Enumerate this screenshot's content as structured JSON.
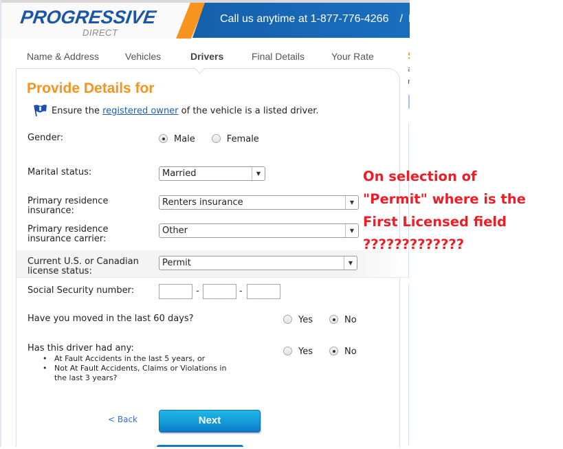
{
  "header": {
    "logo_main": "PROGRESSIVE",
    "logo_sub": "DIRECT",
    "logo_reg": "®",
    "banner_text": "Call us anytime at 1-877-776-4266",
    "banner_slash": "/",
    "banner_more": "E-m",
    "brand_blue": "#1c56a6",
    "brand_orange": "#f7941d"
  },
  "nav": {
    "items": [
      {
        "label": "Name & Address",
        "active": false
      },
      {
        "label": "Vehicles",
        "active": false
      },
      {
        "label": "Drivers",
        "active": true
      },
      {
        "label": "Final Details",
        "active": false
      },
      {
        "label": "Your Rate",
        "active": false
      }
    ]
  },
  "form": {
    "title": "Provide Details for",
    "info": {
      "icon": "flag-icon",
      "prefix": "Ensure the ",
      "link": "registered owner",
      "suffix": " of the vehicle is a listed driver."
    },
    "gender": {
      "label": "Gender:",
      "options": [
        "Male",
        "Female"
      ],
      "selected": "Male"
    },
    "marital_status": {
      "label": "Marital status:",
      "value": "Married"
    },
    "residence_insurance": {
      "label_line1": "Primary residence",
      "label_line2": "insurance:",
      "value": "Renters insurance"
    },
    "residence_carrier": {
      "label_line1": "Primary residence",
      "label_line2": "insurance carrier:",
      "value": "Other"
    },
    "license_status": {
      "label_line1": "Current U.S. or Canadian",
      "label_line2": "license status:",
      "value": "Permit"
    },
    "ssn": {
      "label": "Social Security number:",
      "part1": "",
      "part2": "",
      "part3": "",
      "separator": "-"
    },
    "moved": {
      "label": "Have you moved in the last 60 days?",
      "options": [
        "Yes",
        "No"
      ],
      "selected": "No"
    },
    "incidents": {
      "label": "Has this driver had any:",
      "bullet1": "At Fault Accidents in the last 5 years, or",
      "bullet2_line1": "Not At Fault Accidents, Claims or Violations in",
      "bullet2_line2": "the last 3 years?",
      "options": [
        "Yes",
        "No"
      ],
      "selected": "No"
    },
    "back_label": "< Back",
    "next_label": "Next"
  },
  "sidebar": {
    "s": "S",
    "a": "a",
    "r": "r"
  },
  "annotation": {
    "line1": "On selection of",
    "line2": "\"Permit\" where is the",
    "line3": "First Licensed field",
    "line4": "?????????????",
    "color": "#ee1c25"
  }
}
